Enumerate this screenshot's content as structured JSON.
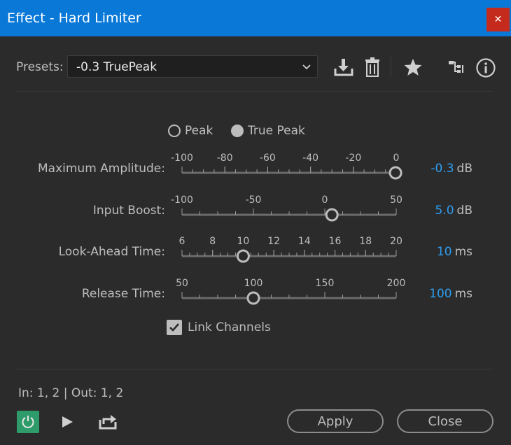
{
  "window": {
    "title": "Effect - Hard Limiter",
    "close_glyph": "✕"
  },
  "presets": {
    "label": "Presets:",
    "value": "-0.3 TruePeak"
  },
  "toolbar": {
    "icons": [
      "save-preset-icon",
      "delete-preset-icon",
      "favorite-star-icon",
      "routing-icon",
      "info-icon"
    ]
  },
  "mode": {
    "peak_label": "Peak",
    "true_peak_label": "True Peak",
    "selected": "True Peak"
  },
  "sliders": [
    {
      "label": "Maximum Amplitude:",
      "ticks": [
        "-100",
        "-80",
        "-60",
        "-40",
        "-20",
        "0"
      ],
      "min": -100,
      "max": 0,
      "value": -0.3,
      "display": "-0.3",
      "unit": "dB"
    },
    {
      "label": "Input Boost:",
      "ticks": [
        "-100",
        "-50",
        "0",
        "50"
      ],
      "min": -100,
      "max": 50,
      "value": 5.0,
      "display": "5.0",
      "unit": "dB"
    },
    {
      "label": "Look-Ahead Time:",
      "ticks": [
        "6",
        "8",
        "10",
        "12",
        "14",
        "16",
        "18",
        "20"
      ],
      "min": 6,
      "max": 20,
      "value": 10,
      "display": "10",
      "unit": "ms"
    },
    {
      "label": "Release Time:",
      "ticks": [
        "50",
        "100",
        "150",
        "200"
      ],
      "min": 50,
      "max": 200,
      "value": 100,
      "display": "100",
      "unit": "ms"
    }
  ],
  "link_channels": {
    "label": "Link Channels",
    "checked": true
  },
  "io_text": "In: 1, 2 | Out: 1, 2",
  "buttons": {
    "apply": "Apply",
    "close": "Close"
  },
  "colors": {
    "titlebar": "#0a78d7",
    "accent_value": "#2d9df0",
    "power_on": "#2e9b6a",
    "close_button": "#c42b1c"
  }
}
